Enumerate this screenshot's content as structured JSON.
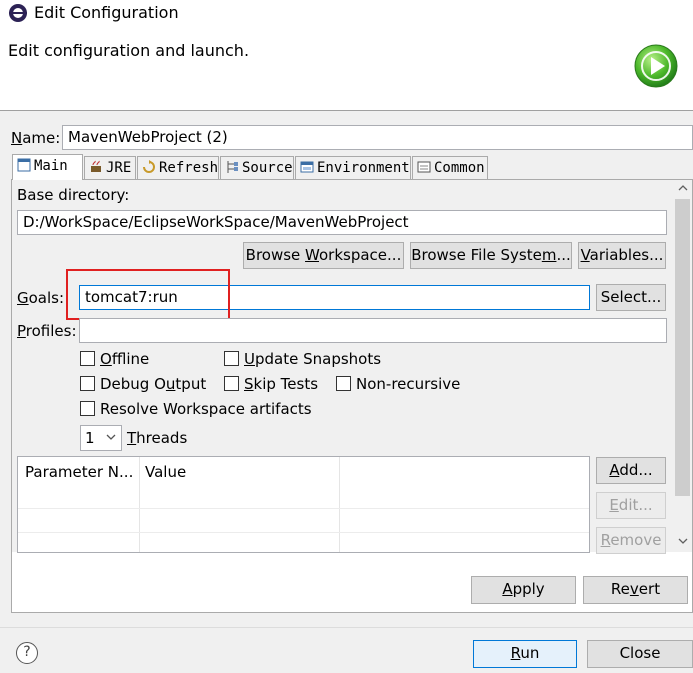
{
  "window": {
    "title": "Edit Configuration"
  },
  "header": {
    "description": "Edit configuration and launch."
  },
  "name": {
    "label": "Name:",
    "value": "MavenWebProject (2)"
  },
  "tabs": [
    {
      "label": "Main",
      "icon": "main-tab-icon",
      "active": true
    },
    {
      "label": "JRE",
      "icon": "jre-icon"
    },
    {
      "label": "Refresh",
      "icon": "refresh-icon"
    },
    {
      "label": "Source",
      "icon": "source-icon"
    },
    {
      "label": "Environment",
      "icon": "environment-icon"
    },
    {
      "label": "Common",
      "icon": "common-icon"
    }
  ],
  "main": {
    "base_dir_label": "Base directory:",
    "base_dir_value": "D:/WorkSpace/EclipseWorkSpace/MavenWebProject",
    "browse_workspace": "Browse Workspace...",
    "browse_filesystem": "Browse File System...",
    "variables": "Variables...",
    "goals_label": "Goals:",
    "goals_value": "tomcat7:run",
    "goals_select": "Select...",
    "profiles_label": "Profiles:",
    "profiles_value": "",
    "checkboxes": {
      "offline": "Offline",
      "update_snapshots": "Update Snapshots",
      "debug_output": "Debug Output",
      "skip_tests": "Skip Tests",
      "non_recursive": "Non-recursive",
      "resolve_workspace": "Resolve Workspace artifacts"
    },
    "threads_value": "1",
    "threads_label": "Threads",
    "table": {
      "columns": [
        "Parameter N...",
        "Value"
      ]
    },
    "add": "Add...",
    "edit": "Edit...",
    "remove": "Remove"
  },
  "buttons": {
    "apply": "Apply",
    "revert": "Revert",
    "run": "Run",
    "close": "Close",
    "help": "?"
  },
  "colors": {
    "highlight": "#e02020",
    "focus_border": "#0078d7"
  }
}
